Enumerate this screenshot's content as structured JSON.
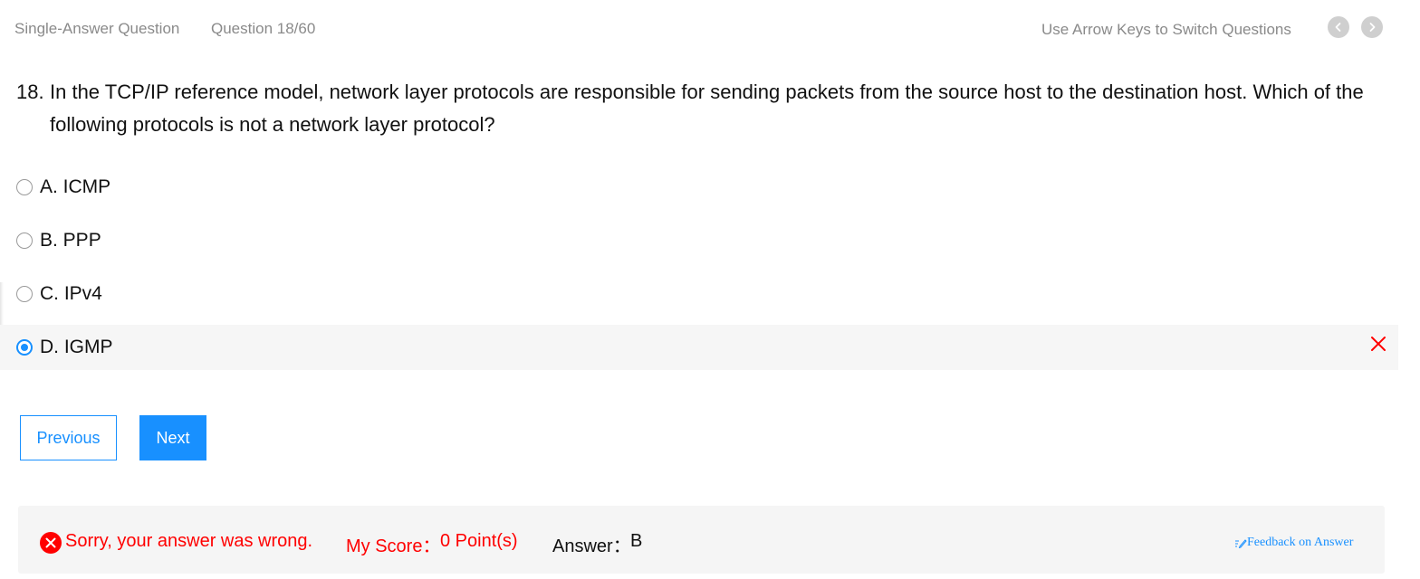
{
  "header": {
    "question_type": "Single-Answer Question",
    "question_counter": "Question 18/60",
    "hint": "Use Arrow Keys to Switch Questions",
    "prev_icon": "chevron-left-icon",
    "next_icon": "chevron-right-icon"
  },
  "question": {
    "number": "18.",
    "text": "In the TCP/IP reference model, network layer protocols are responsible for sending packets from the source host to the destination host. Which of the following protocols is not a network layer protocol?"
  },
  "options": [
    {
      "label": "A. ICMP",
      "selected": false
    },
    {
      "label": "B. PPP",
      "selected": false
    },
    {
      "label": "C. IPv4",
      "selected": false
    },
    {
      "label": "D. IGMP",
      "selected": true,
      "marked_wrong": true
    }
  ],
  "buttons": {
    "previous": "Previous",
    "next": "Next"
  },
  "result": {
    "message": "Sorry, your answer was wrong.",
    "score_label": "My Score：",
    "score_value": "0 Point(s)",
    "answer_label": "Answer：",
    "answer_value": "B",
    "feedback": "Feedback on Answer"
  },
  "colors": {
    "accent": "#1890ff",
    "error": "#ff0000",
    "muted_text": "#8a8a8a",
    "selected_row_bg": "#f6f6f6",
    "result_bg": "#f5f5f5"
  }
}
